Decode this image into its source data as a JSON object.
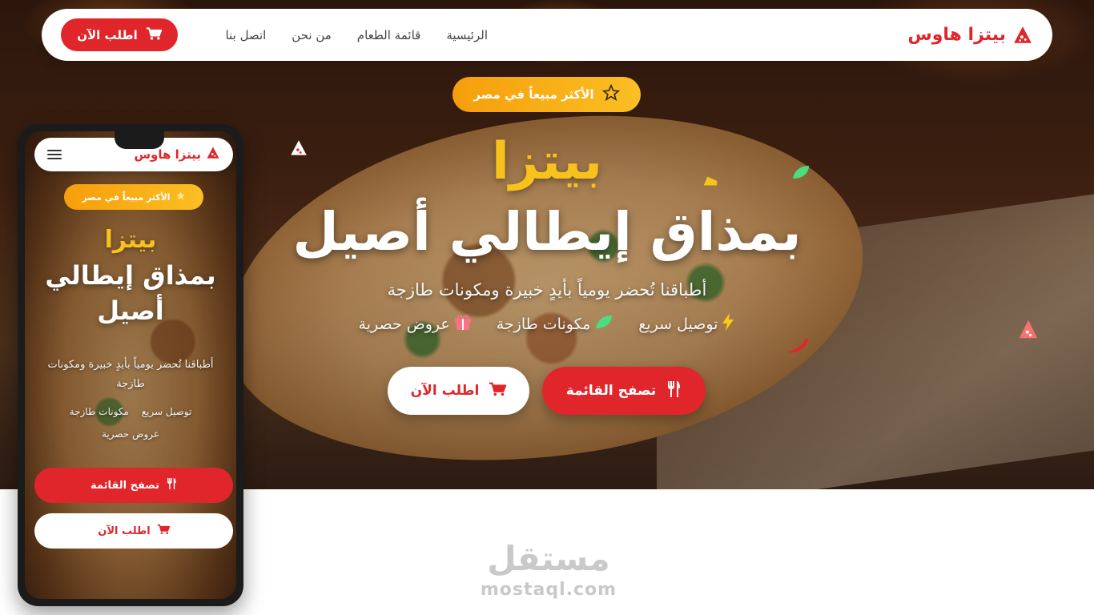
{
  "brand": {
    "name": "بيتزا هاوس",
    "icon": "pizza-slice-icon",
    "color": "#e0262a"
  },
  "nav": {
    "links": [
      "الرئيسية",
      "قائمة الطعام",
      "من نحن",
      "اتصل بنا"
    ],
    "cta": {
      "label": "اطلب الآن",
      "icon": "cart-icon"
    }
  },
  "hero": {
    "badge": {
      "label": "الأكثر مبيعاً في مصر",
      "icon": "star-icon"
    },
    "title_line1": "بيتزا",
    "title_line2": "بمذاق إيطالي أصيل",
    "subtitle": "أطباقنا تُحضر يومياً بأيدٍ خبيرة ومكونات طازجة",
    "features": [
      {
        "label": "توصيل سريع",
        "icon": "lightning-icon"
      },
      {
        "label": "مكونات طازجة",
        "icon": "leaf-icon"
      },
      {
        "label": "عروض حصرية",
        "icon": "gift-icon"
      }
    ],
    "primary_button": {
      "label": "تصفح القائمة",
      "icon": "fork-knife-icon"
    },
    "secondary_button": {
      "label": "اطلب الآن",
      "icon": "cart-icon"
    }
  },
  "mobile": {
    "brand": "بيتزا هاوس",
    "badge": "الأكثر مبيعاً في مصر",
    "title_line1": "بيتزا",
    "title_line2": "بمذاق إيطالي أصيل",
    "subtitle": "أطباقنا تُحضر يومياً بأيدٍ خبيرة ومكونات طازجة",
    "features": [
      "توصيل سريع",
      "مكونات طازجة",
      "عروض حصرية"
    ],
    "primary_button": "تصفح القائمة",
    "secondary_button": "اطلب الآن"
  },
  "watermark": {
    "arabic": "مستقل",
    "latin": "mostaql.com"
  },
  "colors": {
    "accent": "#e0262a",
    "gold": "#f8c21c",
    "badge": "#f59e0b"
  }
}
